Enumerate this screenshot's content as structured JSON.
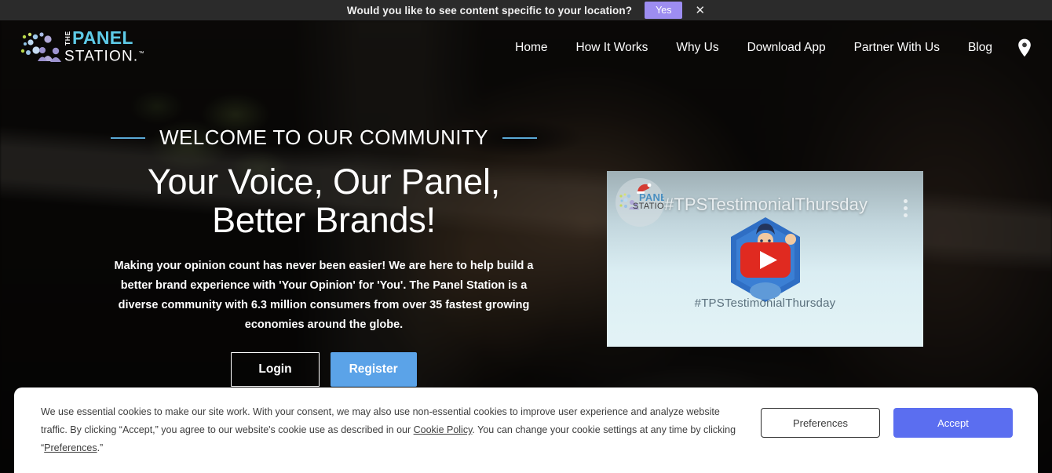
{
  "location_bar": {
    "message": "Would you like to see content specific to your location?",
    "yes_label": "Yes",
    "close_icon": "close-icon"
  },
  "header": {
    "logo": {
      "the": "THE",
      "panel": "PANEL",
      "station": "STATION",
      "tm": "™"
    },
    "nav": [
      {
        "label": "Home"
      },
      {
        "label": "How It Works"
      },
      {
        "label": "Why Us"
      },
      {
        "label": "Download App"
      },
      {
        "label": "Partner With Us"
      },
      {
        "label": "Blog"
      }
    ],
    "location_pin_icon": "location-pin-icon"
  },
  "hero": {
    "eyebrow": "WELCOME TO OUR COMMUNITY",
    "headline_line1": "Your Voice, Our Panel,",
    "headline_line2": "Better Brands!",
    "paragraph": "Making your opinion count has never been easier! We are here to help build a better brand experience with 'Your Opinion' for 'You'. The Panel Station is a diverse community with 6.3 million consumers from over 35 fastest growing economies around the globe.",
    "login_label": "Login",
    "register_label": "Register",
    "accent_color": "#5aa9d6",
    "register_color": "#5ba3e8"
  },
  "video": {
    "title": "#TPSTestimonialThursday",
    "caption": "#TPSTestimonialThursday",
    "avatar_panel": "PANEL",
    "avatar_station": "STATION",
    "play_icon": "play-button-icon",
    "menu_icon": "kebab-menu-icon"
  },
  "cookie_banner": {
    "text_part1": "We use essential cookies to make our site work. With your consent, we may also use non-essential cookies to improve user experience and analyze website traffic. By clicking “Accept,” you agree to our website's cookie use as described in our ",
    "link_policy": "Cookie Policy",
    "text_part2": ". You can change your cookie settings at any time by clicking “",
    "link_preferences": "Preferences",
    "text_part3": ".”",
    "preferences_label": "Preferences",
    "accept_label": "Accept",
    "accept_color": "#5b6ef0"
  }
}
